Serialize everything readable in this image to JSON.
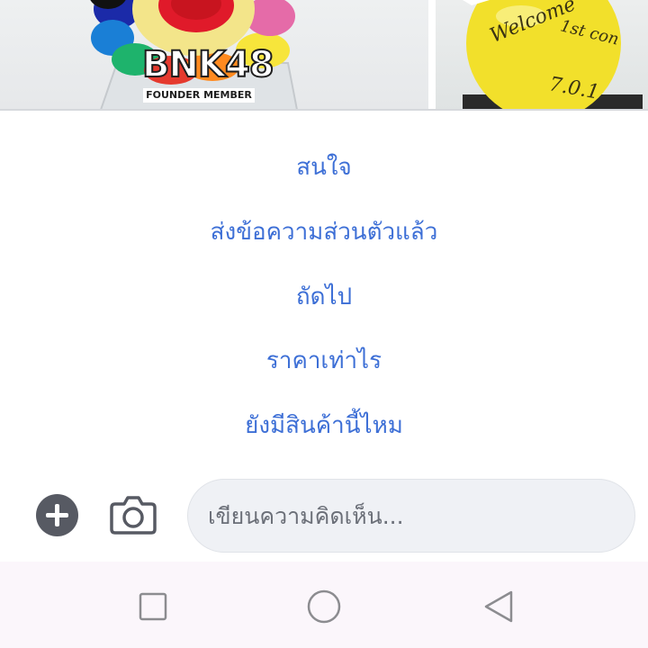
{
  "photos": {
    "left": {
      "badge_logo": "BNK48",
      "badge_caption": "FOUNDER MEMBER"
    },
    "right": {
      "ball_writing_line1": "Welcome",
      "ball_writing_line2": "1st con",
      "ball_writing_line3": "7.0.1"
    }
  },
  "quick_replies": [
    {
      "label": "สนใจ"
    },
    {
      "label": "ส่งข้อความส่วนตัวแล้ว"
    },
    {
      "label": "ถัดไป"
    },
    {
      "label": "ราคาเท่าไร"
    },
    {
      "label": "ยังมีสินค้านี้ไหม"
    }
  ],
  "composer": {
    "add_icon": "plus-circle-icon",
    "camera_icon": "camera-icon",
    "placeholder": "เขียนความคิดเห็น..."
  },
  "nav_bar": {
    "recents_icon": "square-icon",
    "home_icon": "circle-icon",
    "back_icon": "triangle-back-icon"
  },
  "colors": {
    "quick_reply_text": "#3d6fd6",
    "add_button_bg": "#575a63",
    "input_bg": "#eff1f5",
    "nav_bg": "#fbf6fb",
    "nav_icon": "#8c8c90"
  }
}
